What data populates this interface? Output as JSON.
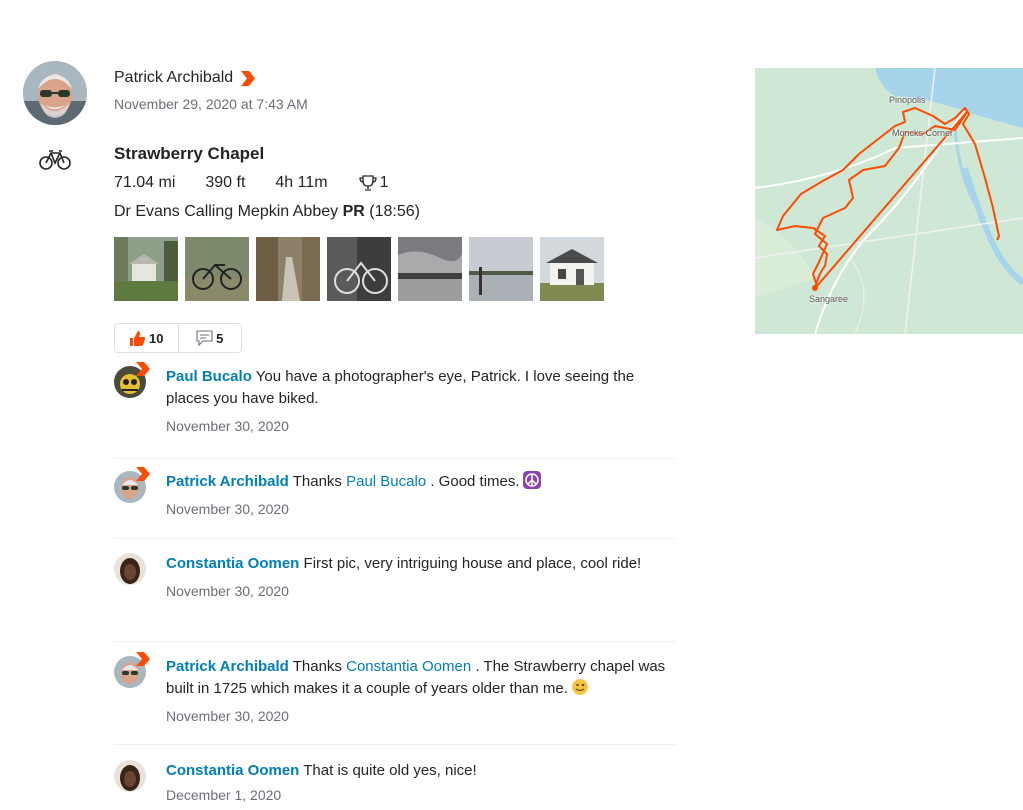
{
  "athlete": {
    "name": "Patrick Archibald",
    "timestamp": "November 29, 2020 at 7:43 AM"
  },
  "sport_icon": "bike-icon",
  "activity": {
    "title": "Strawberry Chapel",
    "stats": {
      "distance": "71.04 mi",
      "elevation": "390 ft",
      "time": "4h 11m",
      "achievements": "1"
    },
    "segment": {
      "name": "Dr Evans Calling Mepkin Abbey",
      "pr_label": "PR",
      "pr_time": "(18:56)"
    },
    "photo_count": 7
  },
  "social": {
    "kudos_count": "10",
    "comment_count": "5"
  },
  "comments": [
    {
      "author": "Paul Bucalo",
      "text": "You have a photographer's eye, Patrick. I love seeing the places you have biked.",
      "date": "November 30, 2020"
    },
    {
      "author": "Patrick Archibald",
      "text_before": "Thanks",
      "mention": "Paul Bucalo",
      "text_after": ". Good times.",
      "emoji": "peace-icon",
      "date": "November 30, 2020"
    },
    {
      "author": "Constantia Oomen",
      "text": "First pic, very intriguing house and place, cool ride!",
      "date": "November 30, 2020"
    },
    {
      "author": "Patrick Archibald",
      "text_before": "Thanks",
      "mention": "Constantia Oomen",
      "text_after": ". The Strawberry chapel was built in 1725 which makes it a couple of years older than me.",
      "emoji": "wink-icon",
      "date": "November 30, 2020"
    },
    {
      "author": "Constantia Oomen",
      "text": "That is quite old yes, nice!",
      "date": "December 1, 2020"
    }
  ],
  "map": {
    "labels": {
      "pinopolis": "Pinopolis",
      "moncks_corner": "Moncks Corner",
      "sangaree": "Sangaree"
    },
    "route_color": "#fc4c02"
  },
  "colors": {
    "brand": "#fc4c02",
    "link": "#007fb6",
    "text": "#242428",
    "muted": "#6d6d78"
  }
}
